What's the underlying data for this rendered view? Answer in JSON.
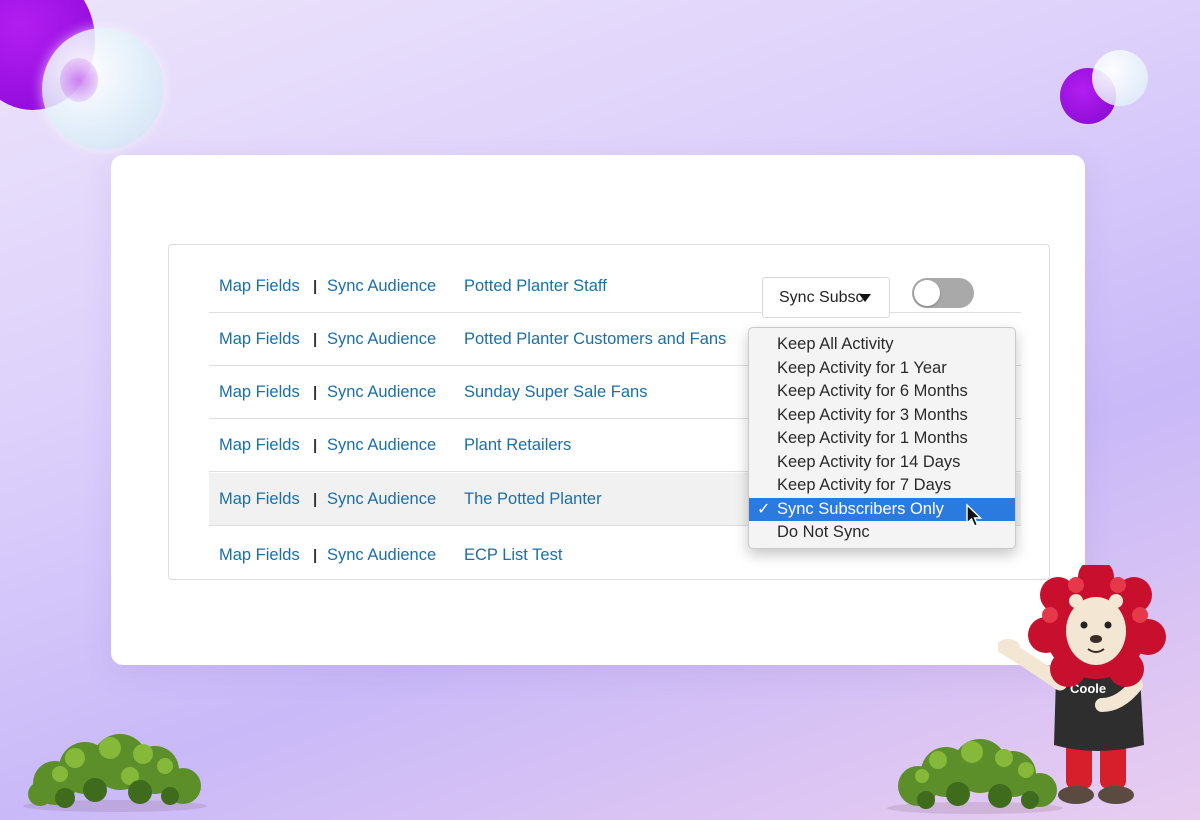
{
  "rows": [
    {
      "map_fields": "Map Fields",
      "separator": "|",
      "sync_audience": "Sync Audience",
      "name": "Potted Planter Staff"
    },
    {
      "map_fields": "Map Fields",
      "separator": "|",
      "sync_audience": "Sync Audience",
      "name": "Potted Planter Customers and Fans"
    },
    {
      "map_fields": "Map Fields",
      "separator": "|",
      "sync_audience": "Sync Audience",
      "name": "Sunday Super Sale Fans"
    },
    {
      "map_fields": "Map Fields",
      "separator": "|",
      "sync_audience": "Sync Audience",
      "name": "Plant Retailers"
    },
    {
      "map_fields": "Map Fields",
      "separator": "|",
      "sync_audience": "Sync Audience",
      "name": "The Potted Planter"
    },
    {
      "map_fields": "Map Fields",
      "separator": "|",
      "sync_audience": "Sync Audience",
      "name": "ECP List Test"
    }
  ],
  "sync_select": {
    "value": "Sync Subsc"
  },
  "toggle": {
    "state": "off"
  },
  "dropdown": {
    "options": [
      "Keep All Activity",
      "Keep Activity for 1 Year",
      "Keep Activity for 6 Months",
      "Keep Activity for 3 Months",
      "Keep Activity for 1 Months",
      "Keep Activity for 14 Days",
      "Keep Activity for 7 Days",
      "Sync Subscribers Only",
      "Do Not Sync"
    ],
    "selected": "Sync Subscribers Only",
    "check_mark": "✓"
  },
  "mascot": {
    "shirt_text": "Coole"
  },
  "colors": {
    "link": "#1a6fa8",
    "selected": "#2b7ae0",
    "accent_purple": "#9b10e0"
  }
}
